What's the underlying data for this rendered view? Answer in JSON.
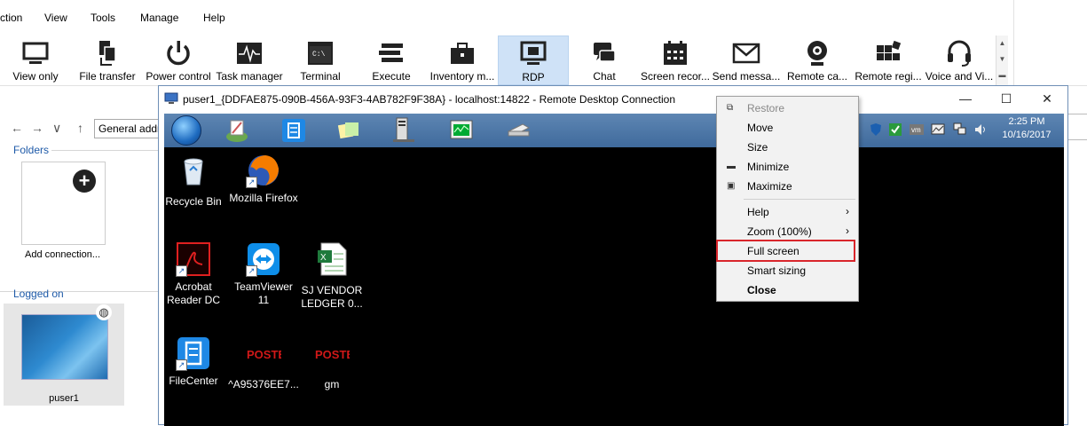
{
  "menubar": {
    "items": [
      "ction",
      "View",
      "Tools",
      "Manage",
      "Help"
    ]
  },
  "ribbon": {
    "buttons": [
      {
        "label": "View only",
        "icon": "monitor-icon"
      },
      {
        "label": "File transfer",
        "icon": "file-transfer-icon"
      },
      {
        "label": "Power control",
        "icon": "power-icon"
      },
      {
        "label": "Task manager",
        "icon": "task-manager-icon"
      },
      {
        "label": "Terminal",
        "icon": "terminal-icon"
      },
      {
        "label": "Execute",
        "icon": "execute-icon"
      },
      {
        "label": "Inventory m...",
        "icon": "inventory-icon"
      },
      {
        "label": "RDP",
        "icon": "rdp-icon",
        "selected": true
      },
      {
        "label": "Chat",
        "icon": "chat-icon"
      },
      {
        "label": "Screen recor...",
        "icon": "screen-recorder-icon"
      },
      {
        "label": "Send messa...",
        "icon": "envelope-icon"
      },
      {
        "label": "Remote ca...",
        "icon": "webcam-icon"
      },
      {
        "label": "Remote regi...",
        "icon": "registry-icon"
      },
      {
        "label": "Voice and Vi...",
        "icon": "headset-icon"
      }
    ]
  },
  "nav": {
    "back": "←",
    "forward": "→",
    "down": "∨",
    "up": "↑",
    "address": "General addre"
  },
  "folders": {
    "title": "Folders",
    "add_label": "Add connection..."
  },
  "logged_on": {
    "title": "Logged on",
    "user": "puser1"
  },
  "rdp": {
    "title": "puser1_{DDFAE875-090B-456A-93F3-4AB782F9F38A} - localhost:14822 - Remote Desktop Connection",
    "minimize": "—",
    "maximize": "☐",
    "close": "✕",
    "clock_time": "2:25 PM",
    "clock_date": "10/16/2017",
    "desktop_icons": [
      {
        "label": "Recycle Bin"
      },
      {
        "label": "Mozilla Firefox"
      },
      {
        "label": "Acrobat Reader DC"
      },
      {
        "label": "TeamViewer 11"
      },
      {
        "label": "SJ VENDOR LEDGER 0..."
      },
      {
        "label": "FileCenter"
      },
      {
        "label": "^A95376EE7..."
      },
      {
        "label": "gm"
      }
    ]
  },
  "context_menu": {
    "items": [
      {
        "label": "Restore",
        "disabled": true
      },
      {
        "label": "Move"
      },
      {
        "label": "Size"
      },
      {
        "label": "Minimize"
      },
      {
        "label": "Maximize"
      },
      {
        "label": "Help",
        "submenu": true
      },
      {
        "label": "Zoom (100%)",
        "submenu": true
      },
      {
        "label": "Full screen",
        "highlighted": true
      },
      {
        "label": "Smart sizing"
      },
      {
        "label": "Close",
        "bold": true
      }
    ]
  },
  "colors": {
    "ribbon_selected": "#cfe2f7",
    "section_title": "#1e5aa8",
    "highlight_border": "#d9262c",
    "desktop_bg": "#000000"
  }
}
